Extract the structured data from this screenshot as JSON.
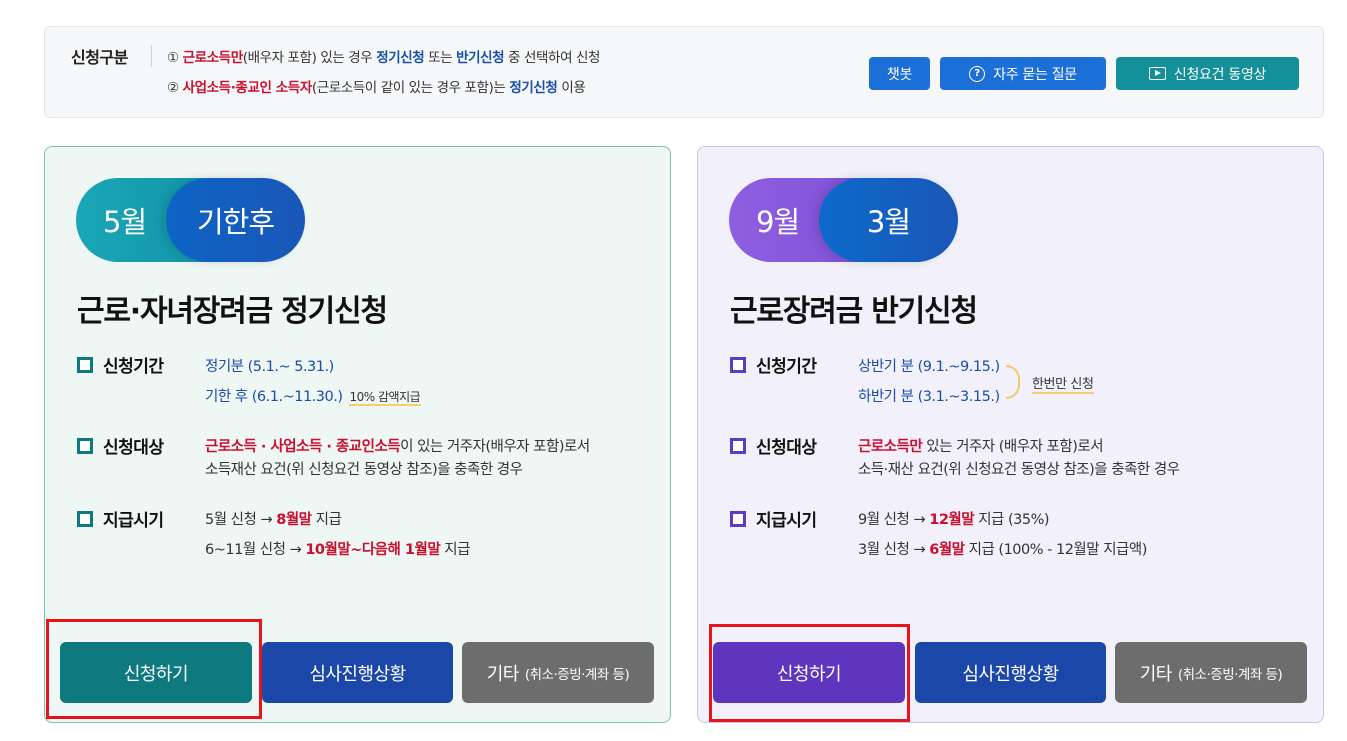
{
  "top": {
    "label": "신청구분",
    "line1": {
      "num": "①",
      "p1": "근로소득만",
      "p2": "(배우자 포함) 있는 경우 ",
      "p3": "정기신청",
      "p4": " 또는 ",
      "p5": "반기신청",
      "p6": " 중 선택하여 신청"
    },
    "line2": {
      "num": "②",
      "p1": "사업소득·종교인 소득자",
      "p2": "(근로소득이 같이 있는 경우 포함)는 ",
      "p3": "정기신청",
      "p4": " 이용"
    },
    "buttons": {
      "chatbot": "챗봇",
      "faq": "자주 묻는 질문",
      "video": "신청요건 동영상"
    }
  },
  "regular": {
    "pill1": "5월",
    "pill2": "기한후",
    "title": "근로·자녀장려금 정기신청",
    "period_label": "신청기간",
    "period1": "정기분 (5.1.~ 5.31.)",
    "period2": "기한 후 (6.1.~11.30.)",
    "period2_note": "10% 감액지급",
    "target_label": "신청대상",
    "target1_red": "근로소득 · 사업소득 · 종교인소득",
    "target1_rest": "이 있는 거주자(배우자 포함)로서",
    "target2": "소득재산 요건(위 신청요건 동영상 참조)을 충족한 경우",
    "pay_label": "지급시기",
    "pay1_a": "5월 신청 → ",
    "pay1_b": "8월말",
    "pay1_c": " 지급",
    "pay2_a": "6~11월 신청 → ",
    "pay2_b": "10월말~다음해 1월말",
    "pay2_c": " 지급",
    "btn_apply": "신청하기",
    "btn_status": "심사진행상황",
    "btn_etc": "기타",
    "btn_etc_small": "(취소·증빙·계좌 등)"
  },
  "half": {
    "pill1": "9월",
    "pill2": "3월",
    "title": "근로장려금 반기신청",
    "period_label": "신청기간",
    "period1": "상반기 분 (9.1.~9.15.)",
    "period2": "하반기 분 (3.1.~3.15.)",
    "once_note": "한번만 신청",
    "target_label": "신청대상",
    "target1_red": "근로소득만",
    "target1_rest": " 있는 거주자 (배우자 포함)로서",
    "target2": "소득·재산 요건(위 신청요건 동영상 참조)을 충족한 경우",
    "pay_label": "지급시기",
    "pay1_a": "9월 신청 → ",
    "pay1_b": "12월말",
    "pay1_c": " 지급 (35%)",
    "pay2_a": "3월 신청 → ",
    "pay2_b": "6월말",
    "pay2_c": " 지급 (100% - 12월말 지급액)",
    "btn_apply": "신청하기",
    "btn_status": "심사진행상황",
    "btn_etc": "기타",
    "btn_etc_small": "(취소·증빙·계좌 등)"
  }
}
